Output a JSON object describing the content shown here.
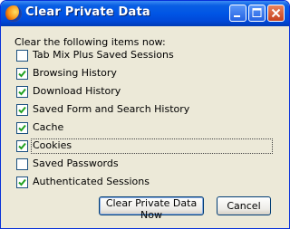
{
  "window": {
    "title": "Clear Private Data"
  },
  "prompt": "Clear the following items now:",
  "items": [
    {
      "label": "Tab Mix Plus Saved Sessions",
      "checked": false,
      "focused": false
    },
    {
      "label": "Browsing History",
      "checked": true,
      "focused": false
    },
    {
      "label": "Download History",
      "checked": true,
      "focused": false
    },
    {
      "label": "Saved Form and Search History",
      "checked": true,
      "focused": false
    },
    {
      "label": "Cache",
      "checked": true,
      "focused": false
    },
    {
      "label": "Cookies",
      "checked": true,
      "focused": true
    },
    {
      "label": "Saved Passwords",
      "checked": false,
      "focused": false
    },
    {
      "label": "Authenticated Sessions",
      "checked": true,
      "focused": false
    }
  ],
  "buttons": {
    "clear": "Clear Private Data Now",
    "cancel": "Cancel"
  },
  "colors": {
    "titlebar": "#0055e5",
    "check": "#21a121",
    "dialog_bg": "#ece9d8"
  },
  "icons": {
    "app": "firefox-icon",
    "minimize": "minimize-icon",
    "maximize": "maximize-icon",
    "close": "close-icon"
  }
}
